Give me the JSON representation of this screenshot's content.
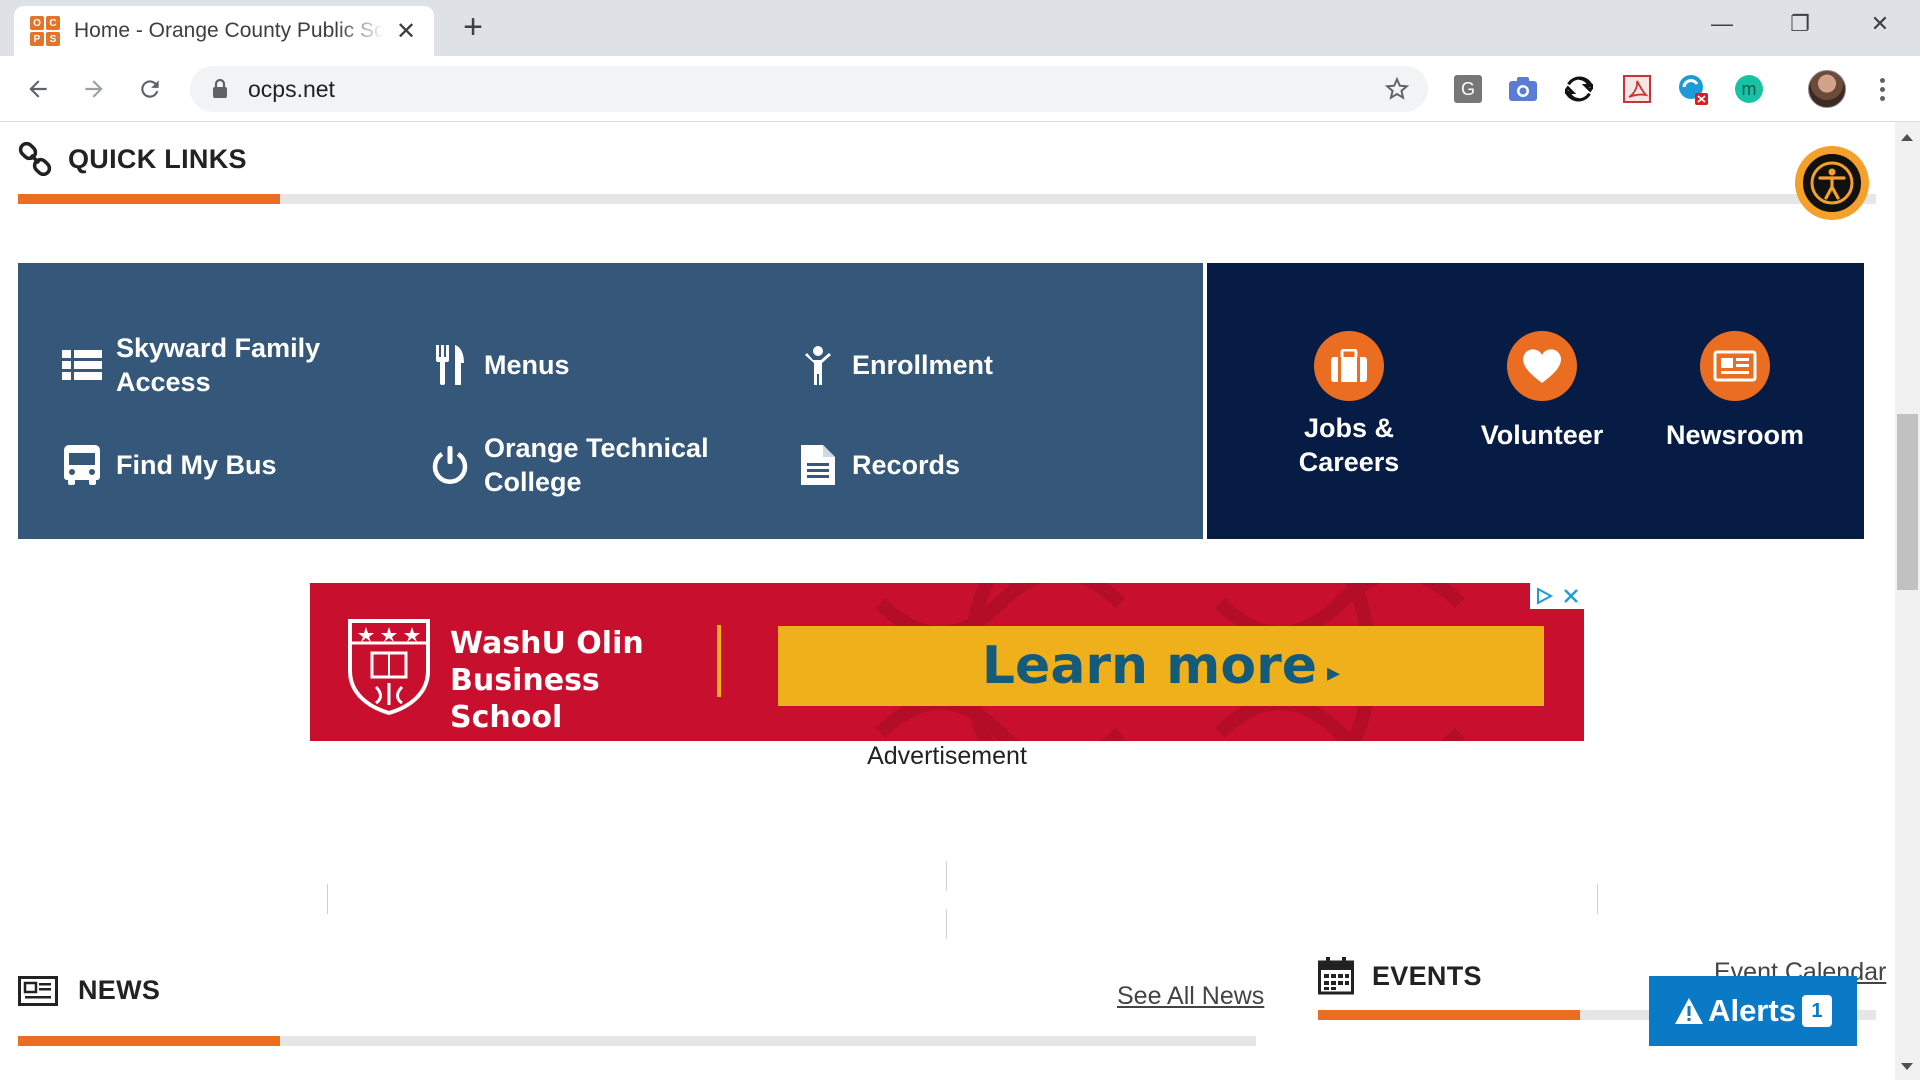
{
  "browser": {
    "tab_title": "Home - Orange County Public Schools",
    "favicon_letters": [
      "O",
      "C",
      "P",
      "S"
    ],
    "url": "ocps.net",
    "new_tab_label": "+",
    "minimize_label": "—",
    "restore_label": "❐",
    "close_label": "✕",
    "extensions": [
      "G",
      "camera-icon",
      "sync-icon",
      "pdf-icon",
      "shield-extension-icon",
      "m"
    ]
  },
  "quick_links": {
    "title": "QUICK LINKS",
    "items": [
      {
        "label": "Skyward Family Access",
        "icon": "list-icon"
      },
      {
        "label": "Menus",
        "icon": "utensils-icon"
      },
      {
        "label": "Enrollment",
        "icon": "child-icon"
      },
      {
        "label": "Find My Bus",
        "icon": "bus-icon"
      },
      {
        "label": "Orange Technical College",
        "icon": "power-icon"
      },
      {
        "label": "Records",
        "icon": "document-icon"
      }
    ],
    "featured": [
      {
        "label": "Jobs & Careers",
        "icon": "briefcase-icon"
      },
      {
        "label": "Volunteer",
        "icon": "heart-icon"
      },
      {
        "label": "Newsroom",
        "icon": "newspaper-icon"
      }
    ]
  },
  "ad": {
    "brand": "WashU Olin Business School",
    "cta": "Learn more",
    "cta_arrow": "▸",
    "caption": "Advertisement"
  },
  "news": {
    "title": "NEWS",
    "link": "See All News"
  },
  "events": {
    "title": "EVENTS",
    "link": "Event Calendar"
  },
  "alerts": {
    "label": "Alerts",
    "count": "1"
  },
  "colors": {
    "accent": "#ea6d22",
    "quick_links_bg": "#35577a",
    "featured_bg": "#061c45",
    "alerts_bg": "#0b7ac6"
  }
}
